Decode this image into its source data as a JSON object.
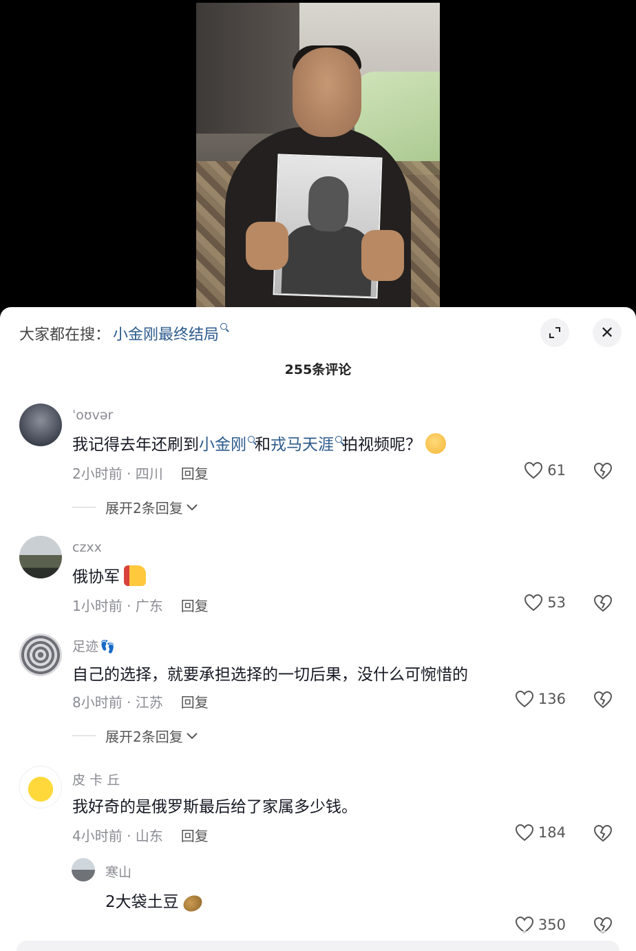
{
  "search_bar": {
    "prefix": "大家都在搜：",
    "query": "小金刚最终结局"
  },
  "header": {
    "comment_count": "255条评论",
    "expand_icon": "expand-icon",
    "close_icon": "close-icon",
    "close_glyph": "✕"
  },
  "comments": [
    {
      "username": "ˈoʊvər",
      "text_parts": [
        "我记得去年还刷到",
        "小金刚",
        "和",
        "戎马天涯",
        "拍视频呢？"
      ],
      "time": "2小时前 · 四川",
      "reply": "回复",
      "likes": "61",
      "expand": "展开2条回复"
    },
    {
      "username": "czxx",
      "text": "俄协军",
      "time": "1小时前 · 广东",
      "reply": "回复",
      "likes": "53"
    },
    {
      "username": "足迹",
      "text": "自己的选择，就要承担选择的一切后果，没什么可惋惜的",
      "time": "8小时前 · 江苏",
      "reply": "回复",
      "likes": "136",
      "expand": "展开2条回复"
    },
    {
      "username": "皮 卡 丘",
      "text": "我好奇的是俄罗斯最后给了家属多少钱。",
      "time": "4小时前 · 山东",
      "reply": "回复",
      "likes": "184"
    }
  ],
  "sub_reply": {
    "username": "寒山",
    "text": "2大袋土豆",
    "likes": "350"
  },
  "colors": {
    "link": "#2c5a8c",
    "meta": "#8a8b91"
  }
}
